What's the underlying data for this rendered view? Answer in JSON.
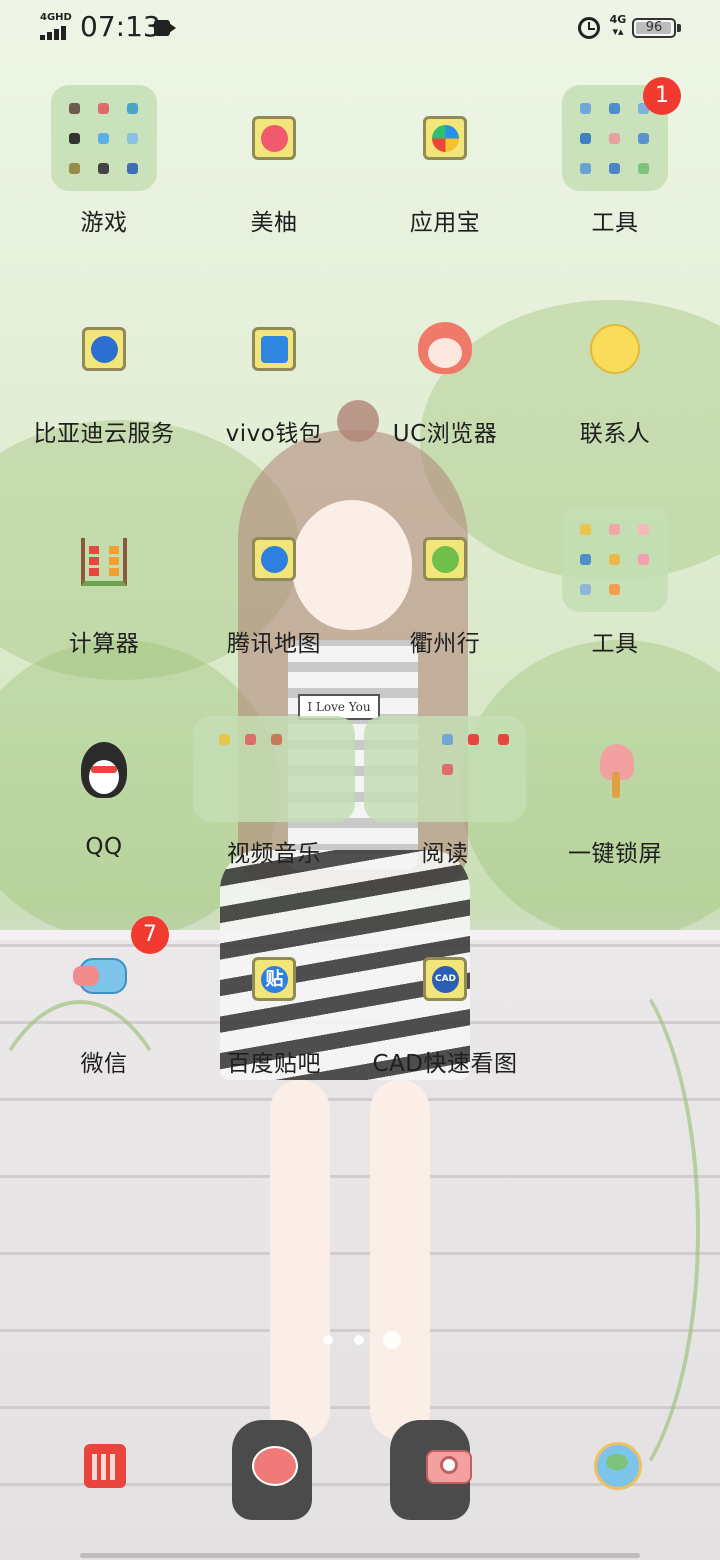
{
  "status_bar": {
    "network_tag": "4GHD",
    "time": "07:13",
    "mobile_data_tag": "4G",
    "battery_level": 96,
    "battery_text": "96"
  },
  "apps": [
    {
      "label": "游戏",
      "badge": ""
    },
    {
      "label": "美柚",
      "badge": ""
    },
    {
      "label": "应用宝",
      "badge": ""
    },
    {
      "label": "工具",
      "badge": "1"
    },
    {
      "label": "比亚迪云服务",
      "badge": ""
    },
    {
      "label": "vivo钱包",
      "badge": ""
    },
    {
      "label": "UC浏览器",
      "badge": ""
    },
    {
      "label": "联系人",
      "badge": ""
    },
    {
      "label": "计算器",
      "badge": ""
    },
    {
      "label": "腾讯地图",
      "badge": ""
    },
    {
      "label": "衢州行",
      "badge": ""
    },
    {
      "label": "工具",
      "badge": ""
    },
    {
      "label": "QQ",
      "badge": ""
    },
    {
      "label": "视频音乐",
      "badge": ""
    },
    {
      "label": "阅读",
      "badge": ""
    },
    {
      "label": "一键锁屏",
      "badge": ""
    },
    {
      "label": "微信",
      "badge": "7"
    },
    {
      "label": "百度贴吧",
      "badge": ""
    },
    {
      "label": "CAD快速看图",
      "badge": ""
    }
  ],
  "wallpaper_text": "I Love You",
  "icon_text": {
    "tieba": "贴",
    "cad": "CAD"
  },
  "dock": [
    {
      "name": "phone"
    },
    {
      "name": "messages"
    },
    {
      "name": "camera"
    },
    {
      "name": "browser"
    }
  ],
  "colors": {
    "badge": "#f23b30",
    "folder": "#c4deb4",
    "wallpaper_green": "#d8e8c8"
  }
}
